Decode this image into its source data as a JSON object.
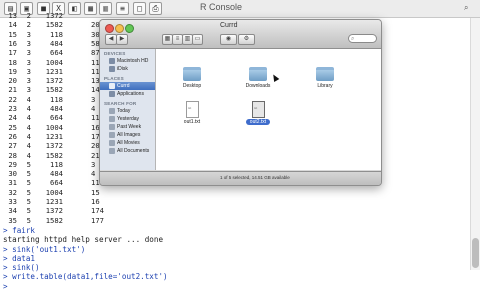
{
  "toolbar": {
    "title": "R Console",
    "right_text": "⌕"
  },
  "table_rows": [
    [
      "13",
      "2",
      "1372",
      ""
    ],
    [
      "14",
      "2",
      "1582",
      "20"
    ],
    [
      "15",
      "3",
      "118",
      "30"
    ],
    [
      "16",
      "3",
      "484",
      "58"
    ],
    [
      "17",
      "3",
      "664",
      "87"
    ],
    [
      "18",
      "3",
      "1004",
      "11"
    ],
    [
      "19",
      "3",
      "1231",
      "11"
    ],
    [
      "20",
      "3",
      "1372",
      "13"
    ],
    [
      "21",
      "3",
      "1582",
      "14"
    ],
    [
      "22",
      "4",
      "118",
      "3"
    ],
    [
      "23",
      "4",
      "484",
      "4"
    ],
    [
      "24",
      "4",
      "664",
      "11"
    ],
    [
      "25",
      "4",
      "1004",
      "16"
    ],
    [
      "26",
      "4",
      "1231",
      "17"
    ],
    [
      "27",
      "4",
      "1372",
      "20"
    ],
    [
      "28",
      "4",
      "1582",
      "21"
    ],
    [
      "29",
      "5",
      "118",
      "3"
    ],
    [
      "30",
      "5",
      "484",
      "4"
    ],
    [
      "31",
      "5",
      "664",
      "11"
    ],
    [
      "32",
      "5",
      "1004",
      "15"
    ],
    [
      "33",
      "5",
      "1231",
      "16"
    ],
    [
      "34",
      "5",
      "1372",
      "174"
    ],
    [
      "35",
      "5",
      "1582",
      "177"
    ]
  ],
  "commands": [
    {
      "type": "in",
      "text": "> fairk"
    },
    {
      "type": "out",
      "text": "starting httpd help server ... done"
    },
    {
      "type": "in",
      "text": "> sink('out1.txt')"
    },
    {
      "type": "in",
      "text": "> data1"
    },
    {
      "type": "in",
      "text": "> sink()"
    },
    {
      "type": "in",
      "text": "> write.table(data1,file='out2.txt')"
    },
    {
      "type": "in",
      "text": ">"
    }
  ],
  "finder": {
    "title": "Currd",
    "search_placeholder": "",
    "sidebar": {
      "devices_header": "DEVICES",
      "devices": [
        "Macintosh HD",
        "iDisk"
      ],
      "places_header": "PLACES",
      "places": [
        "Currd",
        "Applications"
      ],
      "search_header": "SEARCH FOR",
      "searches": [
        "Today",
        "Yesterday",
        "Past Week",
        "All Images",
        "All Movies",
        "All Documents"
      ],
      "selected": "Currd"
    },
    "items": [
      {
        "name": "Desktop",
        "kind": "folder"
      },
      {
        "name": "Downloads",
        "kind": "folder"
      },
      {
        "name": "Library",
        "kind": "folder"
      },
      {
        "name": "out1.txt",
        "kind": "doc"
      },
      {
        "name": "out2.txt",
        "kind": "doc",
        "selected": true
      }
    ],
    "status": "1 of 5 selected, 14.51 GB available"
  },
  "colors": {
    "command_input": "#1b3fb0",
    "selection": "#3e6ccc"
  }
}
